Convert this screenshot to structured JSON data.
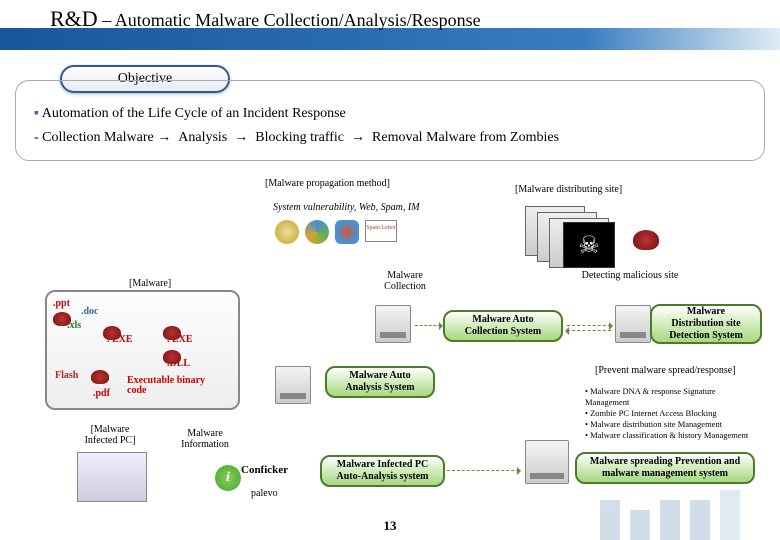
{
  "title_main": "R&D",
  "title_sep": " – ",
  "title_sub": "Automatic Malware Collection/Analysis/Response",
  "objective_label": "Objective",
  "content_line1": "Automation of the Life Cycle of an Incident Response",
  "content_line2_prefix": " - Collection Malware ",
  "content_line2_a": "Analysis",
  "content_line2_b": "Blocking traffic",
  "content_line2_c": "Removal Malware from Zombies",
  "arrow": "→",
  "labels": {
    "propagation": "[Malware propagation method]",
    "vulnerability": "System  vulnerability, Web, Spam, IM",
    "distributing": "[Malware distributing site]",
    "malware_panel": "[Malware]",
    "malware_collection": "Malware Collection",
    "detecting_site": "Detecting malicious site",
    "infected_pc": "[Malware Infected PC]",
    "malware_info": "Malware Information",
    "prevent": "[Prevent malware spread/response]",
    "worm1": "Conficker",
    "worm2": "palevo"
  },
  "systems": {
    "auto_collection": "Malware Auto Collection System",
    "distribution_detection": "Malware Distribution site Detection System",
    "auto_analysis": "Malware Auto Analysis System",
    "infected_auto_analysis": "Malware Infected PC Auto-Analysis system",
    "spreading_prevention": "Malware spreading Prevention and  malware management system"
  },
  "filetypes": {
    "ppt": ".ppt",
    "doc": ".doc",
    "xls": ".xls",
    "exe1": ". EXE",
    "exe2": ". EXE",
    "dll": ".DLL",
    "flash": "Flash",
    "pdf": ".pdf",
    "exec": "Executable binary code"
  },
  "bullets": [
    "Malware DNA & response Signature Management",
    "Zombie PC Internet Access Blocking",
    "Malware distribution site Management",
    "Malware classification & history Management"
  ],
  "page_number": "13",
  "icons": {
    "spam_label": "Spam Letter"
  }
}
